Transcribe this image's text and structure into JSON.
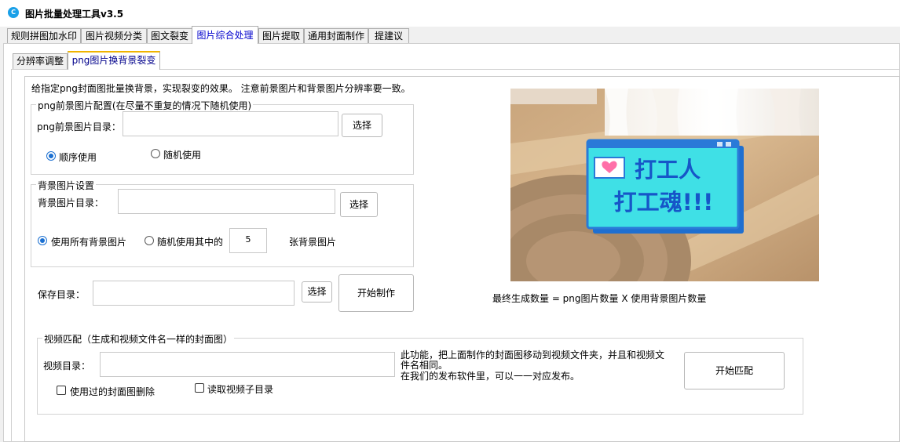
{
  "window": {
    "title": "图片批量处理工具v3.5",
    "icon": "app-logo-icon"
  },
  "tabs": [
    {
      "label": "规则拼图加水印",
      "active": false
    },
    {
      "label": "图片视频分类",
      "active": false
    },
    {
      "label": "图文裂变",
      "active": false
    },
    {
      "label": "图片综合处理",
      "active": true
    },
    {
      "label": "图片提取",
      "active": false
    },
    {
      "label": "通用封面制作",
      "active": false
    },
    {
      "label": "提建议",
      "active": false
    }
  ],
  "subtabs": [
    {
      "label": "分辨率调整",
      "active": false
    },
    {
      "label": "png图片换背景裂变",
      "active": true
    }
  ],
  "main": {
    "intro": "给指定png封面图批量换背景，实现裂变的效果。   注意前景图片和背景图片分辨率要一致。",
    "fg_group": {
      "legend": "png前景图片配置(在尽量不重复的情况下随机使用)",
      "dir_label": "png前景图片目录：",
      "dir_value": "",
      "select_label": "选择",
      "radio_sequential": "顺序使用",
      "radio_random": "随机使用",
      "selected": "sequential"
    },
    "bg_group": {
      "legend": "背景图片设置",
      "dir_label": "背景图片目录：",
      "dir_value": "",
      "select_label": "选择",
      "radio_all": "使用所有背景图片",
      "radio_random": "随机使用其中的",
      "count_value": "5",
      "count_suffix": "张背景图片",
      "selected": "all"
    },
    "save": {
      "label": "保存目录：",
      "value": "",
      "select_label": "选择",
      "start_label": "开始制作"
    },
    "formula": "最终生成数量 =  png图片数量   X   使用背景图片数量",
    "preview": {
      "line1": "打工人",
      "line2": "打工魂!!!"
    }
  },
  "video": {
    "legend": "视频匹配（生成和视频文件名一样的封面图）",
    "dir_label": "视频目录：",
    "dir_value": "",
    "desc1": "此功能，把上面制作的封面图移动到视频文件夹，并且和视频文件名相同。",
    "desc2": "在我们的发布软件里，可以一一对应发布。",
    "check_delete": "使用过的封面图删除",
    "check_subdir": "读取视频子目录",
    "start_label": "开始匹配"
  },
  "colors": {
    "accent": "#1a6fd1",
    "active_tab_text": "#0000cc",
    "subtab_accent": "#f0b400",
    "poster_bg": "#3fe0e6",
    "poster_border": "#2a7ad8",
    "poster_text": "#1656c8"
  }
}
